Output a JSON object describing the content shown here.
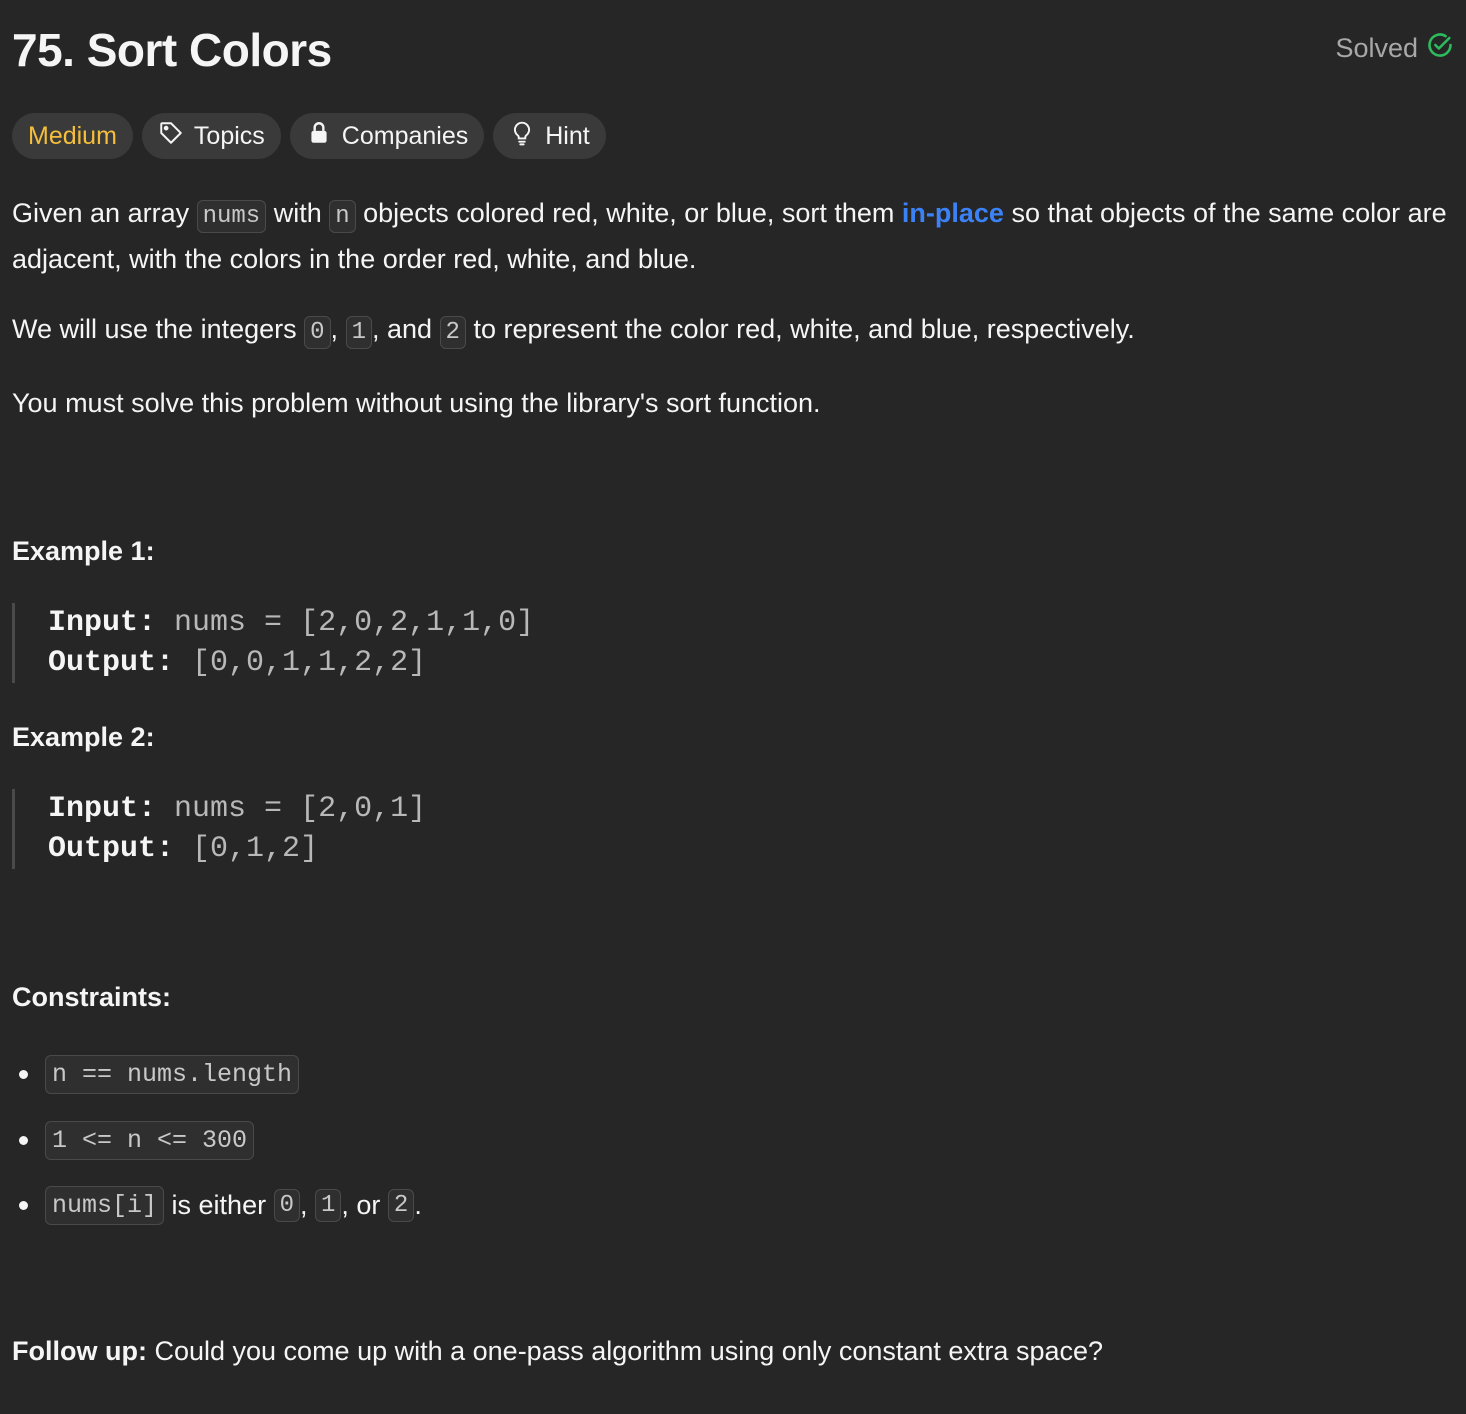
{
  "problem": {
    "title": "75. Sort Colors",
    "status": "Solved"
  },
  "tags": {
    "difficulty": "Medium",
    "topics": "Topics",
    "companies": "Companies",
    "hint": "Hint"
  },
  "description": {
    "p1": {
      "t1": "Given an array ",
      "c1": "nums",
      "t2": " with ",
      "c2": "n",
      "t3": " objects colored red, white, or blue, sort them ",
      "link": "in-place",
      "t4": " so that objects of the same color are adjacent, with the colors in the order red, white, and blue."
    },
    "p2": {
      "t1": "We will use the integers ",
      "c1": "0",
      "t2": ", ",
      "c2": "1",
      "t3": ", and ",
      "c3": "2",
      "t4": " to represent the color red, white, and blue, respectively."
    },
    "p3": "You must solve this problem without using the library's sort function."
  },
  "examples": [
    {
      "heading": "Example 1:",
      "input_label": "Input:",
      "input": "nums = [2,0,2,1,1,0]",
      "output_label": "Output:",
      "output": "[0,0,1,1,2,2]"
    },
    {
      "heading": "Example 2:",
      "input_label": "Input:",
      "input": "nums = [2,0,1]",
      "output_label": "Output:",
      "output": "[0,1,2]"
    }
  ],
  "constraints": {
    "heading": "Constraints:",
    "c1": "n == nums.length",
    "c2": "1 <= n <= 300",
    "c3": {
      "code": "nums[i]",
      "t1": " is either ",
      "v1": "0",
      "t2": ", ",
      "v2": "1",
      "t3": ", or ",
      "v3": "2",
      "t4": "."
    }
  },
  "followup": {
    "label": "Follow up:",
    "text": " Could you come up with a one-pass algorithm using only constant extra space?"
  },
  "colors": {
    "background": "#262626",
    "medium": "#f5bf3b",
    "link": "#3b82f6",
    "solved_check": "#2cbb5d"
  },
  "icons": [
    "check-circle-icon",
    "tag-icon",
    "lock-icon",
    "lightbulb-icon"
  ]
}
